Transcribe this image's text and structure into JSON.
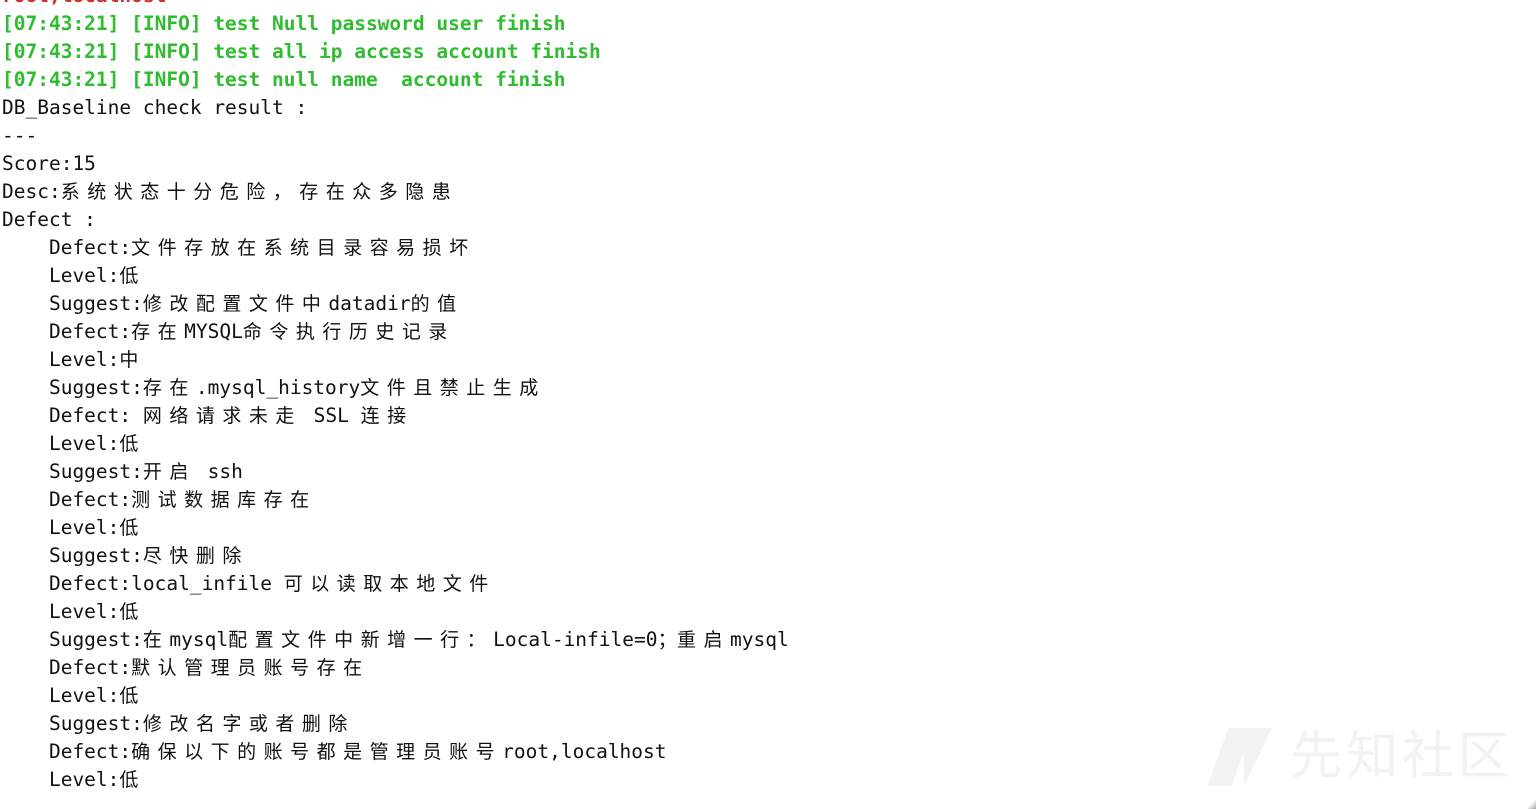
{
  "terminal": {
    "background_color": "#ffffff",
    "default_text_color": "#111111",
    "info_color": "#2fbd2f",
    "alert_color": "#c9342c",
    "lines": [
      {
        "id": "l00",
        "color": "alert",
        "text": "root,localhost"
      },
      {
        "id": "l01",
        "color": "info",
        "text": "[07:43:21] [INFO] test Null password user finish"
      },
      {
        "id": "l02",
        "color": "info",
        "text": "[07:43:21] [INFO] test all ip access account finish"
      },
      {
        "id": "l03",
        "color": "info",
        "text": "[07:43:21] [INFO] test null name  account finish"
      },
      {
        "id": "l04",
        "color": "default",
        "text": "DB_Baseline check result :"
      },
      {
        "id": "l05",
        "color": "default",
        "text": "---"
      },
      {
        "id": "l06",
        "color": "default",
        "text": "Score:15"
      },
      {
        "id": "l07",
        "color": "default",
        "ascii": "Desc:",
        "cjk": "系统状态十分危险，存在众多隐患"
      },
      {
        "id": "l08",
        "color": "default",
        "text": "Defect :"
      },
      {
        "id": "l09",
        "color": "default",
        "indent": 4,
        "ascii": "Defect:",
        "cjk": "文件存放在系统目录容易损坏"
      },
      {
        "id": "l10",
        "color": "default",
        "indent": 4,
        "ascii": "Level:",
        "cjk_tight": "低"
      },
      {
        "id": "l11",
        "color": "default",
        "indent": 4,
        "ascii": "Suggest:",
        "cjk": "修改配置文件中",
        "ascii2": "datadir",
        "cjk2": "的值"
      },
      {
        "id": "l12",
        "color": "default",
        "indent": 4,
        "ascii": "Defect:",
        "cjk": "存在",
        "ascii2": "MYSQL",
        "cjk2": "命令执行历史记录"
      },
      {
        "id": "l13",
        "color": "default",
        "indent": 4,
        "ascii": "Level:",
        "cjk_tight": "中"
      },
      {
        "id": "l14",
        "color": "default",
        "indent": 4,
        "ascii": "Suggest:",
        "cjk": "存在",
        "ascii2": ".mysql_history",
        "cjk2": "文件且禁止生成"
      },
      {
        "id": "l15",
        "color": "default",
        "indent": 4,
        "ascii": "Defect: ",
        "cjk": "网络请求未走",
        "ascii2": " SSL ",
        "cjk2": "连接"
      },
      {
        "id": "l16",
        "color": "default",
        "indent": 4,
        "ascii": "Level:",
        "cjk_tight": "低"
      },
      {
        "id": "l17",
        "color": "default",
        "indent": 4,
        "ascii": "Suggest:",
        "cjk": "开启",
        "ascii2": " ssh"
      },
      {
        "id": "l18",
        "color": "default",
        "indent": 4,
        "ascii": "Defect:",
        "cjk": "测试数据库存在"
      },
      {
        "id": "l19",
        "color": "default",
        "indent": 4,
        "ascii": "Level:",
        "cjk_tight": "低"
      },
      {
        "id": "l20",
        "color": "default",
        "indent": 4,
        "ascii": "Suggest:",
        "cjk": "尽快删除"
      },
      {
        "id": "l21",
        "color": "default",
        "indent": 4,
        "ascii": "Defect:local_infile ",
        "cjk": "可以读取本地文件"
      },
      {
        "id": "l22",
        "color": "default",
        "indent": 4,
        "ascii": "Level:",
        "cjk_tight": "低"
      },
      {
        "id": "l23",
        "color": "default",
        "indent": 4,
        "ascii": "Suggest:",
        "cjk": "在",
        "ascii2": "mysql",
        "cjk2": "配置文件中新增一行：",
        "ascii3": "Local-infile=0；",
        "cjk3": "重启",
        "ascii4": "mysql"
      },
      {
        "id": "l24",
        "color": "default",
        "indent": 4,
        "ascii": "Defect:",
        "cjk": "默认管理员账号存在"
      },
      {
        "id": "l25",
        "color": "default",
        "indent": 4,
        "ascii": "Level:",
        "cjk_tight": "低"
      },
      {
        "id": "l26",
        "color": "default",
        "indent": 4,
        "ascii": "Suggest:",
        "cjk": "修改名字或者删除"
      },
      {
        "id": "l27",
        "color": "default",
        "indent": 4,
        "ascii": "Defect:",
        "cjk": "确保以下的账号都是管理员账号",
        "ascii2": "root,localhost"
      },
      {
        "id": "l28",
        "color": "default",
        "indent": 4,
        "ascii": "Level:",
        "cjk_tight": "低"
      }
    ]
  },
  "watermark": {
    "text": "先知社区",
    "logo_name": "parallelogram-slash-logo",
    "color": "#f2f2f2"
  }
}
